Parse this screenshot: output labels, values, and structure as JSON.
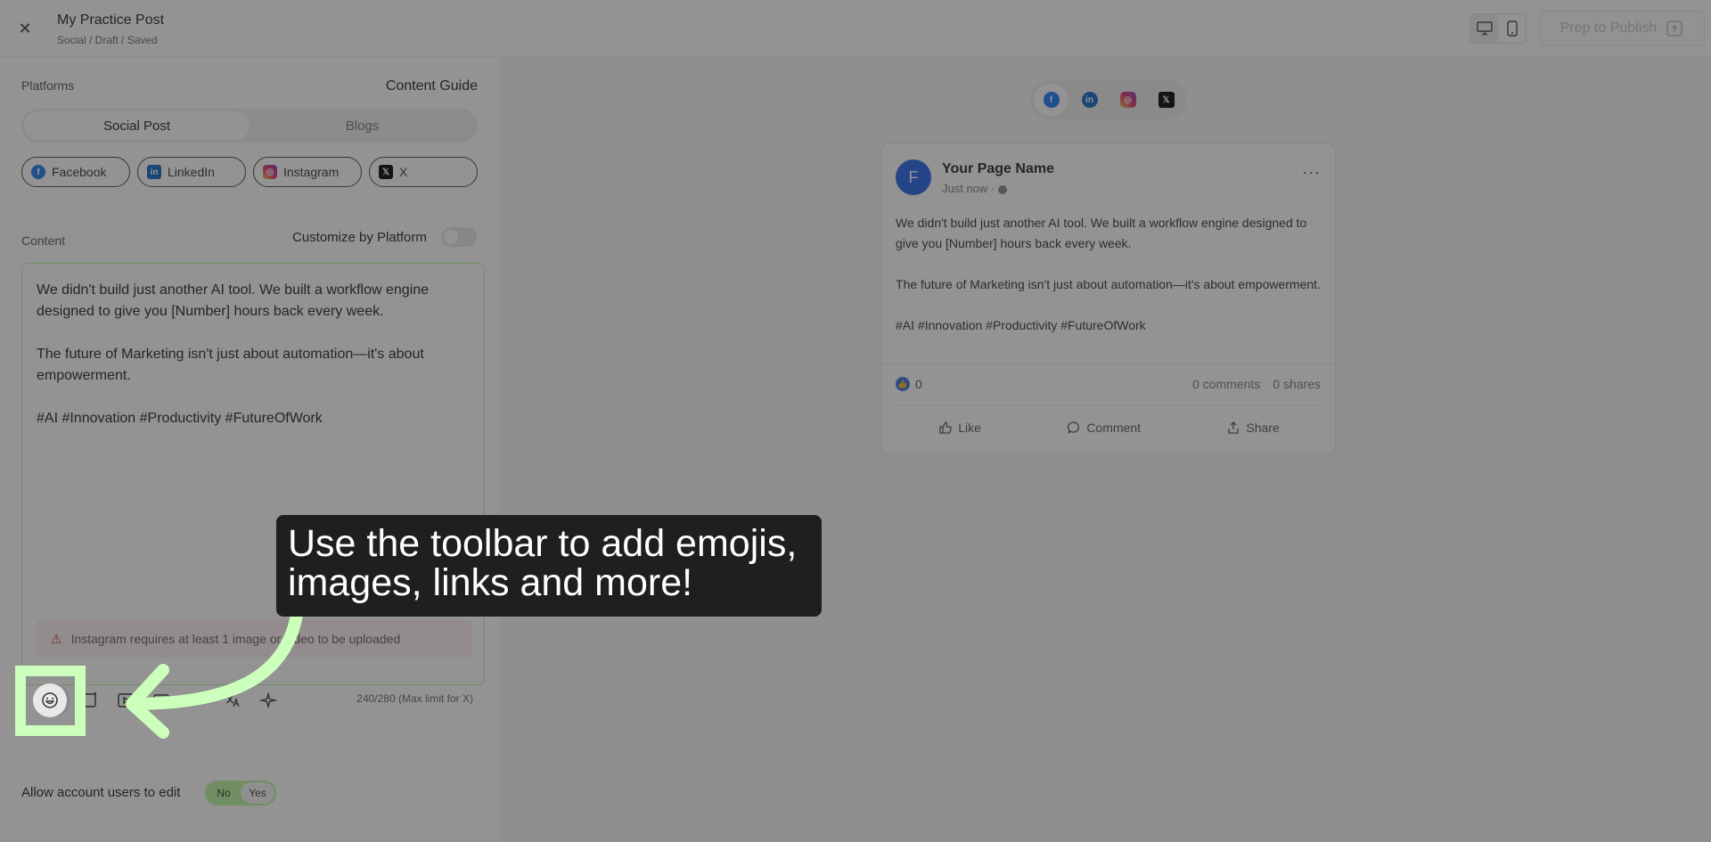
{
  "header": {
    "title": "My Practice Post",
    "breadcrumb": "Social / Draft / Saved",
    "publish_label": "Prep to Publish"
  },
  "left": {
    "platforms_label": "Platforms",
    "content_guide_label": "Content Guide",
    "segments": [
      "Social Post",
      "Blogs"
    ],
    "platform_chips": [
      "Facebook",
      "LinkedIn",
      "Instagram",
      "X"
    ],
    "content_label": "Content",
    "customize_label": "Customize by Platform",
    "editor_paragraphs": [
      "We didn't build just another AI tool. We built a workflow engine designed to give you [Number] hours back every week.",
      "The future of Marketing isn't just about automation—it's about empowerment.",
      "#AI #Innovation #Productivity #FutureOfWork"
    ],
    "warning": "Instagram requires at least 1 image or video to be uploaded",
    "counter": "240/280 (Max limit for X)",
    "allow_label": "Allow account users to edit",
    "allow_no": "No",
    "allow_yes": "Yes"
  },
  "preview": {
    "avatar_letter": "F",
    "page_name": "Your Page Name",
    "time": "Just now ·",
    "paragraphs": [
      "We didn't build just another AI tool. We built a workflow engine designed to give you [Number] hours back every week.",
      "The future of Marketing isn't just about automation—it's about empowerment.",
      "#AI #Innovation #Productivity #FutureOfWork"
    ],
    "reaction_count": "0",
    "comments": "0 comments",
    "shares": "0 shares",
    "like": "Like",
    "comment": "Comment",
    "share": "Share"
  },
  "tooltip": {
    "text": "Use the toolbar to add emojis, images, links and more!"
  },
  "colors": {
    "accent_green": "#b8f59a",
    "highlight_green": "#ccffbb",
    "facebook_blue": "#1877f2",
    "linkedin_blue": "#0a66c2"
  }
}
